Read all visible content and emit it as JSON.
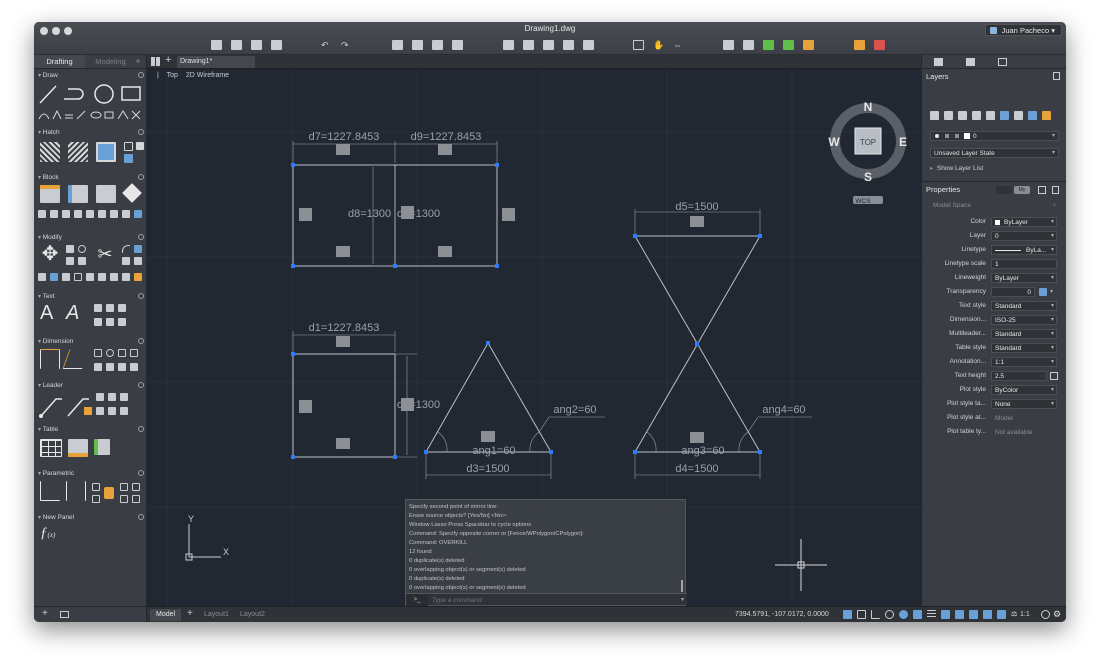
{
  "window": {
    "title": "Drawing1.dwg",
    "user": "Juan Pacheco"
  },
  "palette": {
    "tabs": [
      "Drafting",
      "Modeling"
    ],
    "sections": [
      "Draw",
      "Hatch",
      "Block",
      "Modify",
      "Text",
      "Dimension",
      "Leader",
      "Table",
      "Parametric",
      "New Panel"
    ]
  },
  "doc_tab": "Drawing1*",
  "viewport": {
    "view": "Top",
    "style": "2D Wireframe"
  },
  "viewcube": {
    "n": "N",
    "s": "S",
    "e": "E",
    "w": "W",
    "face": "TOP",
    "wcs": "WCS"
  },
  "ucs": {
    "x": "X",
    "y": "Y"
  },
  "dimensions": {
    "d7": "d7=1227.8453",
    "d9": "d9=1227.8453",
    "d8": "d8=1300",
    "d6": "d6=1300",
    "d1": "d1=1227.8453",
    "d2": "d2=1300",
    "d3": "d3=1500",
    "d4": "d4=1500",
    "d5": "d5=1500",
    "ang1": "ang1=60",
    "ang2": "ang2=60",
    "ang3": "ang3=60",
    "ang4": "ang4=60"
  },
  "command": {
    "history": [
      "Specify second point of mirror line:",
      "Erase source objects? [Yes/No] <No>:",
      "Window Lasso  Press Spacebar to cycle options",
      "Command: Specify opposite corner or [Fence/WPolygon/CPolygon]:",
      "Command: OVERKILL",
      "12 found",
      "0 duplicate(s) deleted",
      "0 overlapping object(s) or segment(s) deleted",
      "0 duplicate(s) deleted",
      "0 overlapping object(s) or segment(s) deleted"
    ],
    "prompt": ">_",
    "placeholder": "Type a command"
  },
  "status": {
    "layouts": [
      "Model",
      "Layout1",
      "Layout2"
    ],
    "coords": "7394.5791, -107.0172, 0.0000",
    "scale": "1:1"
  },
  "layers": {
    "title": "Layers",
    "current_layer": "0",
    "layer_state": "Unsaved Layer State",
    "show_list": "Show Layer List"
  },
  "properties": {
    "title": "Properties",
    "my_label": "My",
    "context": "Model Space",
    "rows": [
      {
        "label": "Color",
        "value": "ByLayer"
      },
      {
        "label": "Layer",
        "value": "0"
      },
      {
        "label": "Linetype",
        "value": "ByLa..."
      },
      {
        "label": "Linetype scale",
        "value": "1"
      },
      {
        "label": "Lineweight",
        "value": "ByLayer"
      },
      {
        "label": "Transparency",
        "value": "0"
      },
      {
        "label": "Text style",
        "value": "Standard"
      },
      {
        "label": "Dimension...",
        "value": "ISO-25"
      },
      {
        "label": "Multileader...",
        "value": "Standard"
      },
      {
        "label": "Table style",
        "value": "Standard"
      },
      {
        "label": "Annotation...",
        "value": "1:1"
      },
      {
        "label": "Text height",
        "value": "2.5"
      },
      {
        "label": "Plot style",
        "value": "ByColor"
      },
      {
        "label": "Plot style ta...",
        "value": "None"
      },
      {
        "label": "Plot style at...",
        "value": "Model"
      },
      {
        "label": "Plot table ty...",
        "value": "Not available"
      }
    ]
  },
  "colors": {
    "canvas": "#222832",
    "geometry": "#b9bec6",
    "grip": "#2e7bff",
    "panel": "#3a3e44",
    "accent": "#e8a23a"
  }
}
